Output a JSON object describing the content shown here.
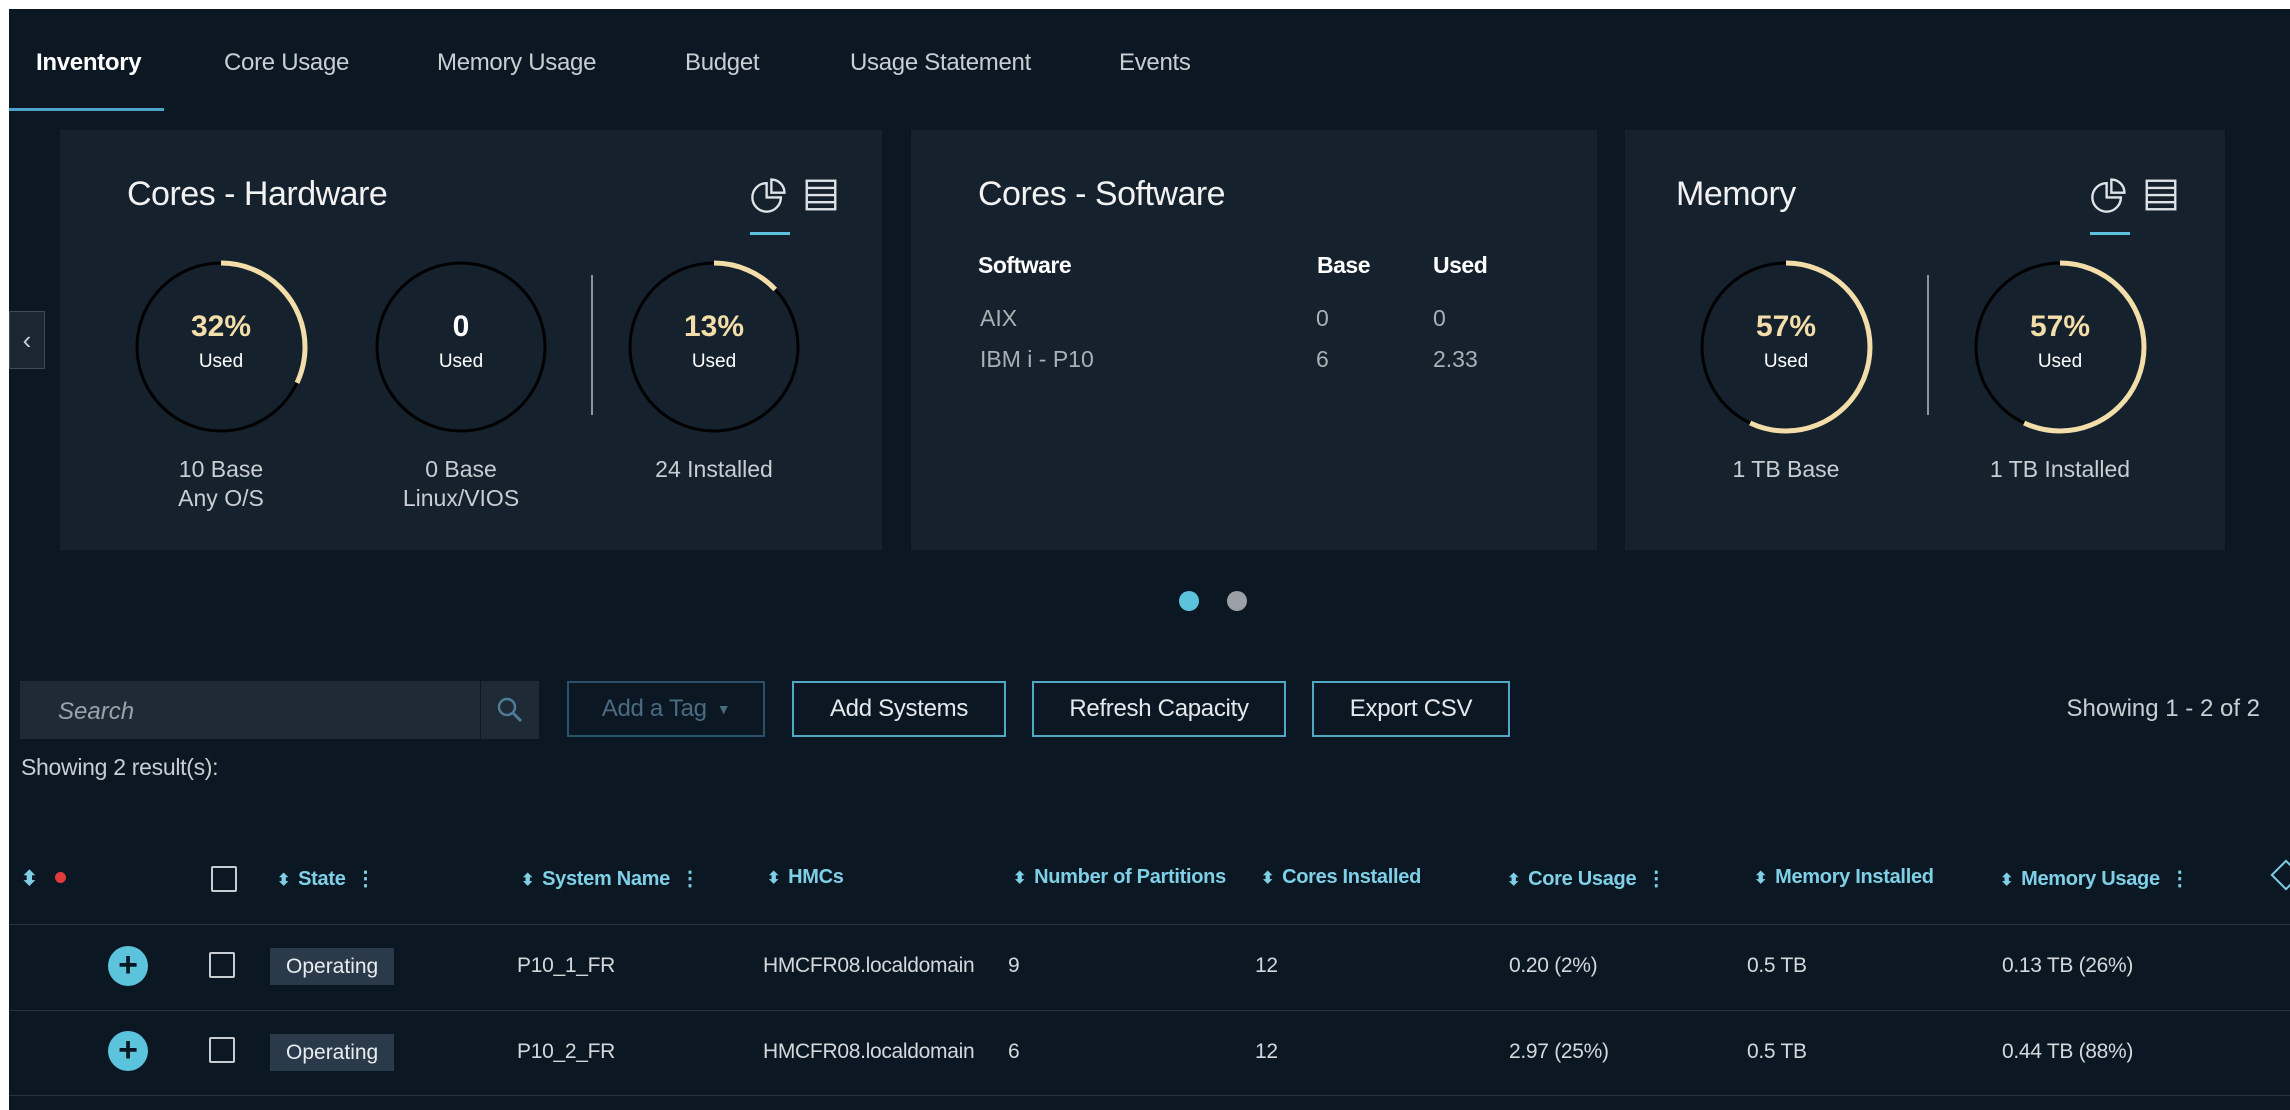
{
  "tabs": [
    {
      "label": "Inventory",
      "active": true
    },
    {
      "label": "Core Usage"
    },
    {
      "label": "Memory Usage"
    },
    {
      "label": "Budget"
    },
    {
      "label": "Usage Statement"
    },
    {
      "label": "Events"
    }
  ],
  "cards": {
    "hardware": {
      "title": "Cores - Hardware",
      "gauges": [
        {
          "pct": "32%",
          "value": 0.32,
          "label": "Used",
          "caption1": "10 Base",
          "caption2": "Any O/S"
        },
        {
          "pct": "0",
          "value": 0,
          "label": "Used",
          "caption1": "0 Base",
          "caption2": "Linux/VIOS"
        },
        {
          "pct": "13%",
          "value": 0.13,
          "label": "Used",
          "caption1": "24 Installed",
          "caption2": ""
        }
      ]
    },
    "software": {
      "title": "Cores - Software",
      "headers": {
        "software": "Software",
        "base": "Base",
        "used": "Used"
      },
      "rows": [
        {
          "software": "AIX",
          "base": "0",
          "used": "0"
        },
        {
          "software": "IBM i - P10",
          "base": "6",
          "used": "2.33"
        }
      ]
    },
    "memory": {
      "title": "Memory",
      "gauges": [
        {
          "pct": "57%",
          "value": 0.57,
          "label": "Used",
          "caption1": "1 TB Base"
        },
        {
          "pct": "57%",
          "value": 0.57,
          "label": "Used",
          "caption1": "1 TB Installed"
        }
      ]
    }
  },
  "pager": {
    "total": 2,
    "active": 1
  },
  "toolbar": {
    "search_placeholder": "Search",
    "add_tag": "Add a Tag",
    "add_systems": "Add Systems",
    "refresh_capacity": "Refresh Capacity",
    "export_csv": "Export CSV",
    "showing": "Showing 1 - 2 of 2"
  },
  "results_text": "Showing 2 result(s):",
  "table": {
    "headers": {
      "state": "State",
      "system_name": "System Name",
      "hmcs": "HMCs",
      "partitions": "Number of Partitions",
      "cores_installed": "Cores Installed",
      "core_usage": "Core Usage",
      "memory_installed": "Memory Installed",
      "memory_usage": "Memory Usage"
    },
    "rows": [
      {
        "state": "Operating",
        "system_name": "P10_1_FR",
        "hmcs": "HMCFR08.localdomain",
        "partitions": "9",
        "cores_installed": "12",
        "core_usage": "0.20 (2%)",
        "memory_installed": "0.5 TB",
        "memory_usage": "0.13 TB (26%)"
      },
      {
        "state": "Operating",
        "system_name": "P10_2_FR",
        "hmcs": "HMCFR08.localdomain",
        "partitions": "6",
        "cores_installed": "12",
        "core_usage": "2.97 (25%)",
        "memory_installed": "0.5 TB",
        "memory_usage": "0.44 TB (88%)"
      }
    ]
  },
  "colors": {
    "background": "#0b1824",
    "card": "#15212d",
    "accent": "#5cc3dc",
    "gauge_fill": "#f3deaa",
    "gauge_track": "#000000",
    "header_text": "#7fd0e6"
  }
}
